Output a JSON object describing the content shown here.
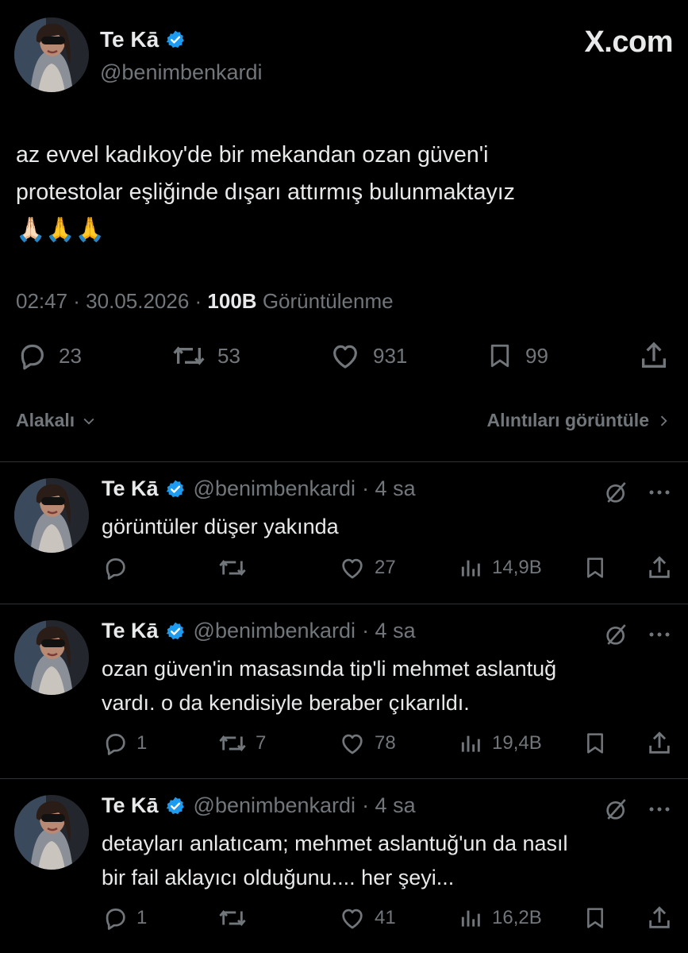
{
  "author": {
    "name": "Te Kā",
    "handle": "@benimbenkardi"
  },
  "brand": "X.com",
  "tweet": {
    "lines": [
      "az evvel kadıkoy'de bir mekandan ozan güven'i",
      "protestolar eşliğinde dışarı attırmış bulunmaktayız",
      "🙏🏻🙏🙏"
    ],
    "time": "02:47 · 30.05.2026 ·",
    "views": "100B",
    "views_label": "Görüntülenme",
    "stats": {
      "replies": "23",
      "reposts": "53",
      "likes": "931",
      "bookmarks": "99"
    }
  },
  "filter_bar": {
    "sort_label": "Alakalı",
    "quotes_label": "Alıntıları görüntüle"
  },
  "replies": [
    {
      "name": "Te Kā",
      "handle": "@benimbenkardi",
      "age": "· 4 sa",
      "lines": [
        "görüntüler düşer yakında"
      ],
      "replies": "",
      "reposts": "",
      "likes": "27",
      "views": "14,9B"
    },
    {
      "name": "Te Kā",
      "handle": "@benimbenkardi",
      "age": "· 4 sa",
      "lines": [
        "ozan güven'in masasında tip'li mehmet aslantuğ",
        "vardı. o da kendisiyle beraber çıkarıldı."
      ],
      "replies": "1",
      "reposts": "7",
      "likes": "78",
      "views": "19,4B"
    },
    {
      "name": "Te Kā",
      "handle": "@benimbenkardi",
      "age": "· 4 sa",
      "lines": [
        "detayları anlatıcam; mehmet aslantuğ'un da nasıl",
        "bir fail aklayıcı olduğunu.... her şeyi..."
      ],
      "replies": "1",
      "reposts": "",
      "likes": "41",
      "views": "16,2B"
    }
  ],
  "colors": {
    "background": "#000000",
    "text": "#e7e9ea",
    "muted": "#71767b",
    "verified": "#1d9bf0",
    "divider": "#2f3336"
  }
}
